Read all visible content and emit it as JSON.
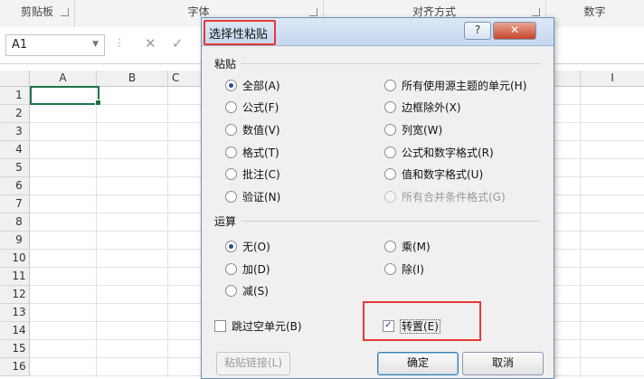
{
  "ribbon": {
    "groups": [
      "剪贴板",
      "字体",
      "对齐方式",
      "数字"
    ]
  },
  "formula_bar": {
    "name_box": "A1",
    "cancel_symbol": "✕",
    "enter_symbol": "✓"
  },
  "grid": {
    "columns": [
      "A",
      "B",
      "C",
      "I"
    ],
    "rows": [
      "1",
      "2",
      "3",
      "4",
      "5",
      "6",
      "7",
      "8",
      "9",
      "10",
      "11",
      "12",
      "13",
      "14",
      "15",
      "16"
    ]
  },
  "dialog": {
    "title": "选择性粘贴",
    "help_symbol": "?",
    "close_symbol": "✕",
    "paste_section": "粘贴",
    "paste_left": [
      "全部(A)",
      "公式(F)",
      "数值(V)",
      "格式(T)",
      "批注(C)",
      "验证(N)"
    ],
    "paste_right": [
      "所有使用源主题的单元(H)",
      "边框除外(X)",
      "列宽(W)",
      "公式和数字格式(R)",
      "值和数字格式(U)",
      "所有合并条件格式(G)"
    ],
    "operation_section": "运算",
    "operation_left": [
      "无(O)",
      "加(D)",
      "减(S)"
    ],
    "operation_right": [
      "乘(M)",
      "除(I)"
    ],
    "skip_blanks": "跳过空单元(B)",
    "transpose": "转置(E)",
    "paste_link": "粘贴链接(L)",
    "ok": "确定",
    "cancel": "取消"
  },
  "state": {
    "paste_selected": "全部(A)",
    "operation_selected": "无(O)",
    "skip_blanks_checked": false,
    "transpose_checked": true
  },
  "colors": {
    "accent_green": "#217346",
    "highlight_red": "#e53935"
  }
}
